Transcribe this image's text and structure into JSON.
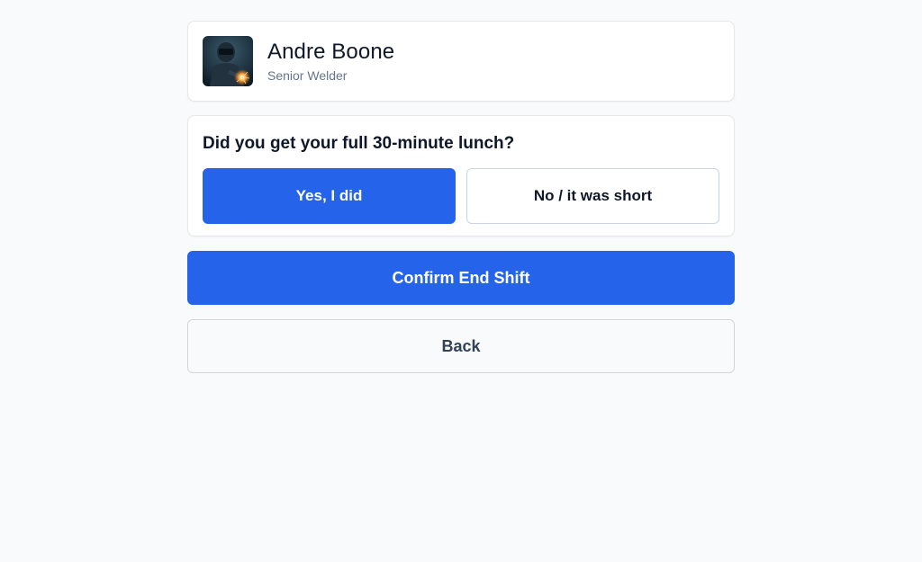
{
  "profile": {
    "avatar_icon": "welder-photo",
    "name": "Andre Boone",
    "role": "Senior Welder"
  },
  "lunch_check": {
    "question": "Did you get your full 30-minute lunch?",
    "yes_label": "Yes, I did",
    "no_label": "No / it was short",
    "selected": "yes"
  },
  "actions": {
    "confirm_label": "Confirm End Shift",
    "back_label": "Back"
  },
  "colors": {
    "accent": "#2563eb",
    "background": "#f8fafc"
  }
}
